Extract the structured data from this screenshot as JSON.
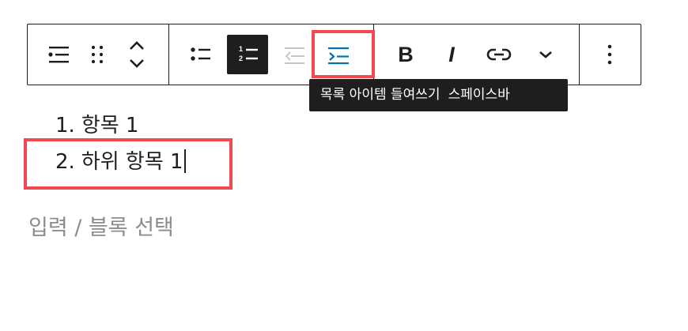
{
  "toolbar": {
    "groups": [
      {
        "buttons": [
          {
            "icon": "list-block-icon",
            "label": "목록"
          },
          {
            "icon": "drag-handle-icon",
            "label": "드래그"
          },
          {
            "icon": "move-up-down-icon",
            "label": "이동"
          }
        ]
      },
      {
        "buttons": [
          {
            "icon": "unordered-list-icon",
            "label": "순서 없는 목록"
          },
          {
            "icon": "ordered-list-icon",
            "label": "순서 있는 목록",
            "active": true
          },
          {
            "icon": "outdent-icon",
            "label": "내어쓰기",
            "disabled": true
          },
          {
            "icon": "indent-icon",
            "label": "들여쓰기",
            "highlighted": true
          }
        ]
      },
      {
        "buttons": [
          {
            "icon": "bold-icon",
            "label": "굵게"
          },
          {
            "icon": "italic-icon",
            "label": "기울임꼴"
          },
          {
            "icon": "link-icon",
            "label": "링크"
          },
          {
            "icon": "chevron-down-icon",
            "label": "더 보기"
          }
        ]
      },
      {
        "buttons": [
          {
            "icon": "more-options-icon",
            "label": "옵션"
          }
        ]
      }
    ]
  },
  "tooltip": {
    "text": "목록 아이템 들여쓰기",
    "shortcut": "스페이스바"
  },
  "list": {
    "items": [
      {
        "number": "1.",
        "text": "항목 1"
      },
      {
        "number": "2.",
        "text": "하위 항목 1"
      }
    ]
  },
  "placeholder": {
    "text": "입력 / 블록 선택"
  },
  "colors": {
    "highlight": "#f2484f",
    "accent": "#0073aa",
    "dark": "#1e1e1e"
  }
}
